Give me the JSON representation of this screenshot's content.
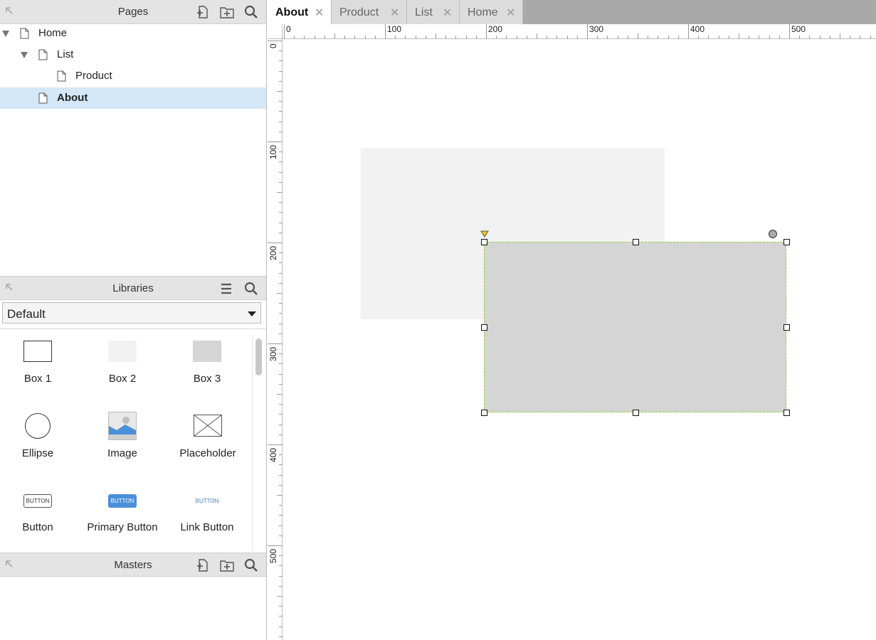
{
  "pages_panel": {
    "title": "Pages",
    "icons": [
      "collapse-arrow-icon",
      "add-page-icon",
      "add-folder-icon",
      "search-icon"
    ],
    "items": [
      {
        "label": "Home",
        "level": 0,
        "expanded": true
      },
      {
        "label": "List",
        "level": 1,
        "expanded": true
      },
      {
        "label": "Product",
        "level": 2
      },
      {
        "label": "About",
        "level": 1,
        "selected": true
      }
    ]
  },
  "libraries_panel": {
    "title": "Libraries",
    "selected_library": "Default",
    "widgets": [
      {
        "label": "Box 1",
        "icon": "box1-icon"
      },
      {
        "label": "Box 2",
        "icon": "box2-icon"
      },
      {
        "label": "Box 3",
        "icon": "box3-icon"
      },
      {
        "label": "Ellipse",
        "icon": "ellipse-icon"
      },
      {
        "label": "Image",
        "icon": "image-icon"
      },
      {
        "label": "Placeholder",
        "icon": "placeholder-icon"
      },
      {
        "label": "Button",
        "icon": "button-widget-icon",
        "preview_text": "BUTTON"
      },
      {
        "label": "Primary Button",
        "icon": "primary-button-widget-icon",
        "preview_text": "BUTTON"
      },
      {
        "label": "Link Button",
        "icon": "link-button-widget-icon",
        "preview_text": "BUTTON"
      }
    ]
  },
  "masters_panel": {
    "title": "Masters"
  },
  "tabs": [
    {
      "label": "About",
      "active": true
    },
    {
      "label": "Product"
    },
    {
      "label": "List"
    },
    {
      "label": "Home"
    }
  ],
  "rulers": {
    "horizontal_labels": [
      "0",
      "100",
      "200",
      "300",
      "400",
      "500"
    ],
    "vertical_labels": [
      "0",
      "100",
      "200",
      "300",
      "400",
      "500"
    ]
  },
  "colors": {
    "selection_border": "#8fd43a",
    "primary_button": "#4a90d9",
    "page_selected": "#d4e7f6",
    "handle_marker": "#f5c518"
  }
}
